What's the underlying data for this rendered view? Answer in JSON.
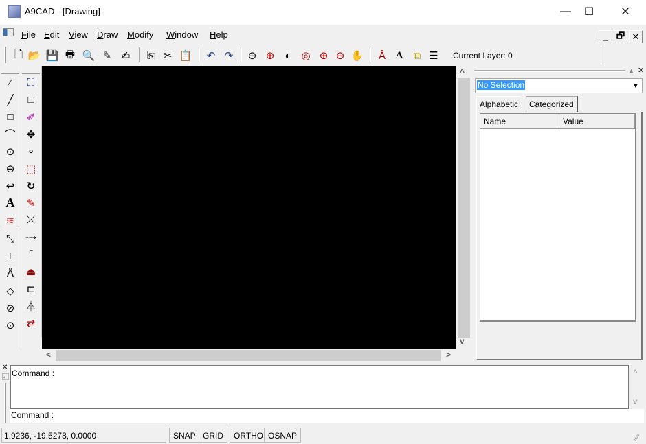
{
  "window": {
    "title": "A9CAD - [Drawing]",
    "minimize": "—",
    "maximize": "☐",
    "close": "✕"
  },
  "menu": {
    "items": [
      {
        "label": "File",
        "accel": "F",
        "rest": "ile"
      },
      {
        "label": "Edit",
        "accel": "E",
        "rest": "dit"
      },
      {
        "label": "View",
        "accel": "V",
        "rest": "iew"
      },
      {
        "label": "Draw",
        "accel": "D",
        "rest": "raw"
      },
      {
        "label": "Modify",
        "accel": "M",
        "rest": "odify"
      },
      {
        "label": "Window",
        "accel": "W",
        "rest": "indow"
      },
      {
        "label": "Help",
        "accel": "H",
        "rest": "elp"
      }
    ],
    "mdi_minimize": "_",
    "mdi_restore": "🗗",
    "mdi_close": "✕"
  },
  "toolbar": {
    "current_layer": "Current Layer: 0"
  },
  "properties": {
    "selection": "No Selection",
    "tabs": [
      "Alphabetic",
      "Categorized"
    ],
    "columns": [
      "Name",
      "Value"
    ]
  },
  "command": {
    "log_line": "Command :",
    "prompt": "Command :"
  },
  "status": {
    "coordinates": "1.9236, -19.5278, 0.0000",
    "buttons": [
      "SNAP",
      "GRID",
      "ORTHO",
      "OSNAP"
    ]
  }
}
